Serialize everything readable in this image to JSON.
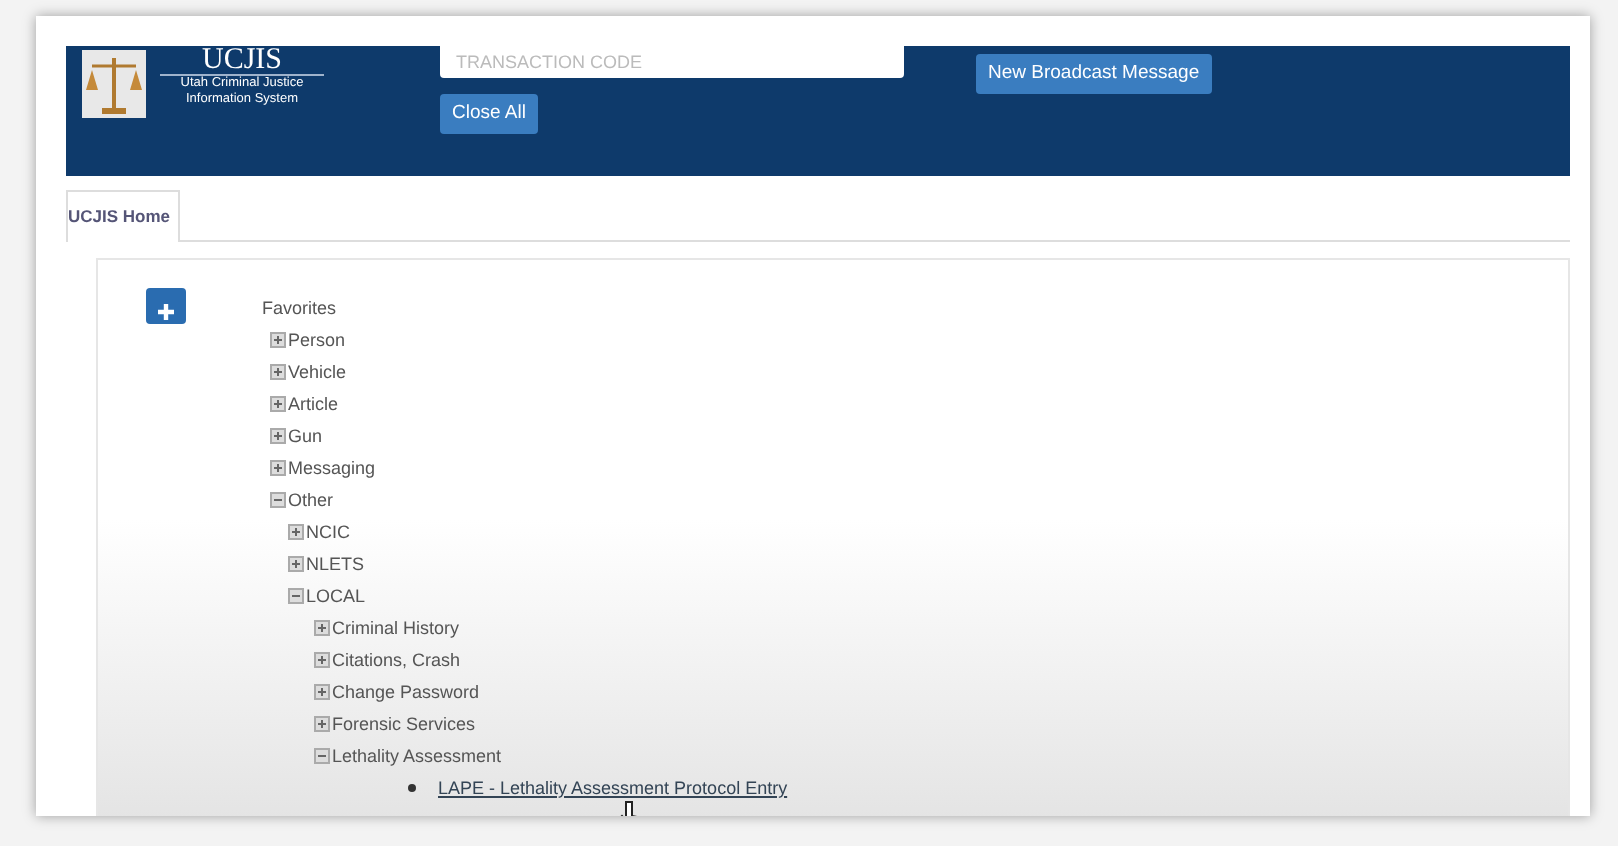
{
  "header": {
    "system_name": "UCJIS",
    "system_subtitle": "Utah Criminal Justice Information System",
    "transaction_field": {
      "placeholder": "TRANSACTION CODE"
    },
    "buttons": [
      {
        "label": "New Broadcast Message"
      },
      {
        "label": "Close All"
      }
    ]
  },
  "tabs": [
    {
      "label": "UCJIS Home",
      "selected": true
    }
  ],
  "tree": [
    {
      "kind": "heading",
      "label": "Favorites"
    },
    {
      "kind": "folder",
      "label": "Person",
      "expanded": false
    },
    {
      "kind": "folder",
      "label": "Vehicle",
      "expanded": false
    },
    {
      "kind": "folder",
      "label": "Article",
      "expanded": false
    },
    {
      "kind": "folder",
      "label": "Gun",
      "expanded": false
    },
    {
      "kind": "folder",
      "label": "Messaging",
      "expanded": false
    },
    {
      "kind": "folder",
      "label": "Other",
      "expanded": true,
      "children": [
        {
          "kind": "folder",
          "label": "NCIC",
          "expanded": false
        },
        {
          "kind": "folder",
          "label": "NLETS",
          "expanded": false
        },
        {
          "kind": "folder",
          "label": "LOCAL",
          "expanded": true,
          "children": [
            {
              "kind": "folder",
              "label": "Criminal History",
              "expanded": false
            },
            {
              "kind": "folder",
              "label": "Citations, Crash",
              "expanded": false
            },
            {
              "kind": "folder",
              "label": "Change Password",
              "expanded": false
            },
            {
              "kind": "folder",
              "label": "Forensic Services",
              "expanded": false
            },
            {
              "kind": "folder",
              "label": "Lethality Assessment",
              "expanded": true,
              "children": [
                {
                  "kind": "link",
                  "label": "LAPE - Lethality Assessment Protocol Entry"
                }
              ]
            }
          ]
        }
      ]
    }
  ]
}
